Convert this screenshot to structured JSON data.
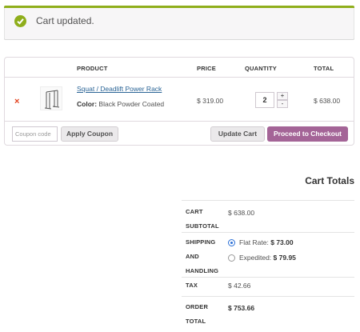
{
  "notice": {
    "message": "Cart updated."
  },
  "cart": {
    "headers": {
      "product": "PRODUCT",
      "price": "PRICE",
      "quantity": "QUANTITY",
      "total": "TOTAL"
    },
    "items": [
      {
        "remove": "×",
        "name": "Squat / Deadlift Power Rack",
        "variation_label": "Color:",
        "variation_value": "Black Powder Coated",
        "price": "$ 319.00",
        "quantity": "2",
        "total": "$ 638.00"
      }
    ],
    "qty_plus": "+",
    "qty_minus": "-",
    "coupon_placeholder": "Coupon code",
    "apply_coupon": "Apply Coupon",
    "update_cart": "Update Cart",
    "checkout": "Proceed to Checkout"
  },
  "totals": {
    "title": "Cart Totals",
    "subtotal_label_1": "CART",
    "subtotal_label_2": "SUBTOTAL",
    "subtotal": "$ 638.00",
    "shipping_label_1": "SHIPPING",
    "shipping_label_2": "AND",
    "shipping_label_3": "HANDLING",
    "shipping_options": [
      {
        "name": "Flat Rate:",
        "price": "$ 73.00",
        "selected": true
      },
      {
        "name": "Expedited:",
        "price": "$ 79.95",
        "selected": false
      }
    ],
    "tax_label": "TAX",
    "tax": "$ 42.66",
    "order_label_1": "ORDER",
    "order_label_2": "TOTAL",
    "order_total": "$ 753.66"
  },
  "colors": {
    "notice_accent": "#8fae1b",
    "checkout_button": "#a46497",
    "link": "#2a6496",
    "remove": "#e2401c"
  }
}
